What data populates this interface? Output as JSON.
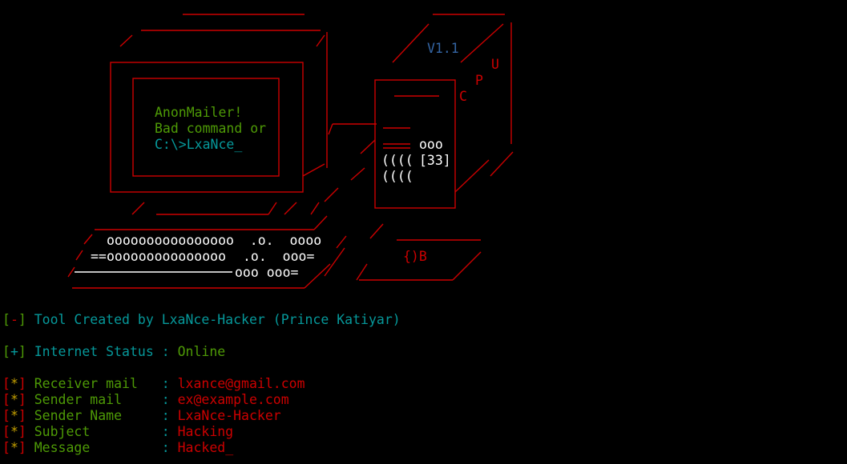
{
  "colors": {
    "background": "#000000",
    "frame_red": "#cc0000",
    "monitor_text_green": "#4e9a06",
    "prompt_cyan": "#06989a",
    "version_blue": "#3465a4",
    "asterisk_yellow": "#c4a000"
  },
  "banner": {
    "version": "V1.1",
    "screen_line1": "AnonMailer!",
    "screen_line2": "Bad command or",
    "screen_prompt": "C:\\>LxaNce_",
    "letter_u": "U",
    "letter_p": "P",
    "letter_c": "C",
    "letter_b": "{)B",
    "counter": "[33]",
    "keys_row1": "oooooooooooooooo  .o.  oooo",
    "keys_row2": "ooooooooooooooo",
    "keys_row2_tail": ".o.  ooo=",
    "keys_row3_tail": "ooo ooo="
  },
  "info": {
    "credit": {
      "marker": "-",
      "text": "Tool Created by LxaNce-Hacker (Prince Katiyar)"
    },
    "internet": {
      "marker": "+",
      "label": "Internet Status",
      "separator": ":",
      "value": "Online"
    },
    "fields": [
      {
        "marker": "*",
        "label": "Receiver mail  ",
        "separator": ":",
        "value": "lxance@gmail.com"
      },
      {
        "marker": "*",
        "label": "Sender mail    ",
        "separator": ":",
        "value": "ex@example.com"
      },
      {
        "marker": "*",
        "label": "Sender Name    ",
        "separator": ":",
        "value": "LxaNce-Hacker"
      },
      {
        "marker": "*",
        "label": "Subject        ",
        "separator": ":",
        "value": "Hacking"
      },
      {
        "marker": "*",
        "label": "Message        ",
        "separator": ":",
        "value": "Hacked"
      }
    ],
    "cursor": "_"
  }
}
